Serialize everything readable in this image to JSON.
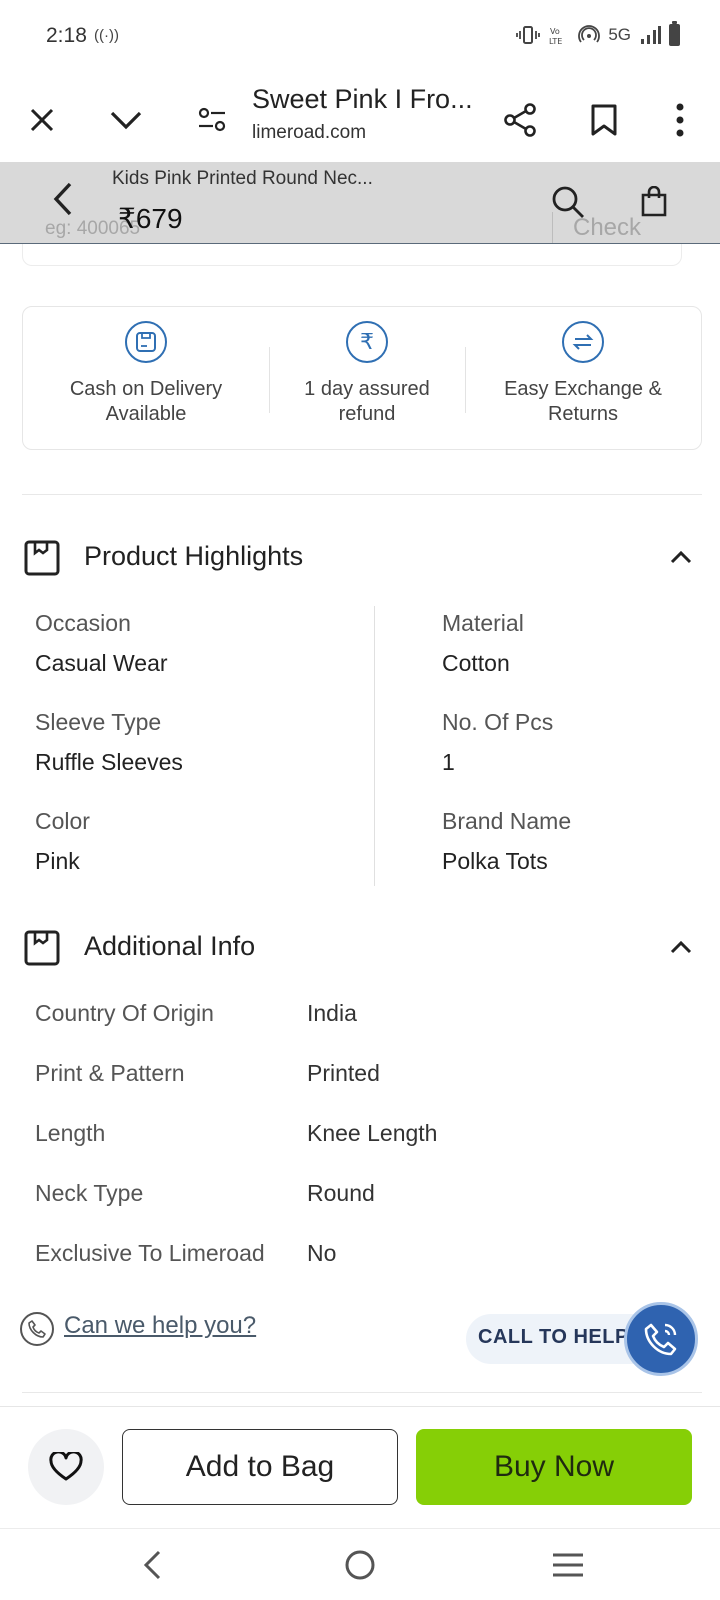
{
  "status_bar": {
    "time": "2:18",
    "network": "5G",
    "icons": [
      "vibrate-icon",
      "volte-icon",
      "hotspot-icon",
      "signal-icon",
      "battery-icon"
    ]
  },
  "browser": {
    "title": "Sweet Pink I Fro...",
    "url": "limeroad.com"
  },
  "sticky_header": {
    "product_title": "Kids Pink Printed Round Nec...",
    "price": "₹679",
    "pincode_placeholder": "eg: 400065",
    "check_label": "Check"
  },
  "services": [
    {
      "icon": "cash-on-delivery-icon",
      "line1": "Cash on Delivery",
      "line2": "Available"
    },
    {
      "icon": "rupee-refund-icon",
      "line1": "1 day assured",
      "line2": "refund"
    },
    {
      "icon": "exchange-icon",
      "line1": "Easy Exchange &",
      "line2": "Returns"
    }
  ],
  "highlights": {
    "title": "Product Highlights",
    "items": [
      {
        "label": "Occasion",
        "value": "Casual Wear"
      },
      {
        "label": "Material",
        "value": "Cotton"
      },
      {
        "label": "Sleeve Type",
        "value": "Ruffle Sleeves"
      },
      {
        "label": "No. Of Pcs",
        "value": "1"
      },
      {
        "label": "Color",
        "value": "Pink"
      },
      {
        "label": "Brand Name",
        "value": "Polka Tots"
      }
    ]
  },
  "additional_info": {
    "title": "Additional Info",
    "rows": [
      {
        "label": "Country Of Origin",
        "value": "India"
      },
      {
        "label": "Print & Pattern",
        "value": "Printed"
      },
      {
        "label": "Length",
        "value": "Knee Length"
      },
      {
        "label": "Neck Type",
        "value": "Round"
      },
      {
        "label": "Exclusive To Limeroad",
        "value": "No"
      }
    ]
  },
  "help": {
    "link_text": "Can we help you?",
    "call_label": "CALL TO HELP"
  },
  "actions": {
    "add_to_bag": "Add to Bag",
    "buy_now": "Buy Now"
  },
  "colors": {
    "accent_blue": "#2f6fb3",
    "buy_green": "#86cf06",
    "header_gray": "#d9d9d9"
  }
}
